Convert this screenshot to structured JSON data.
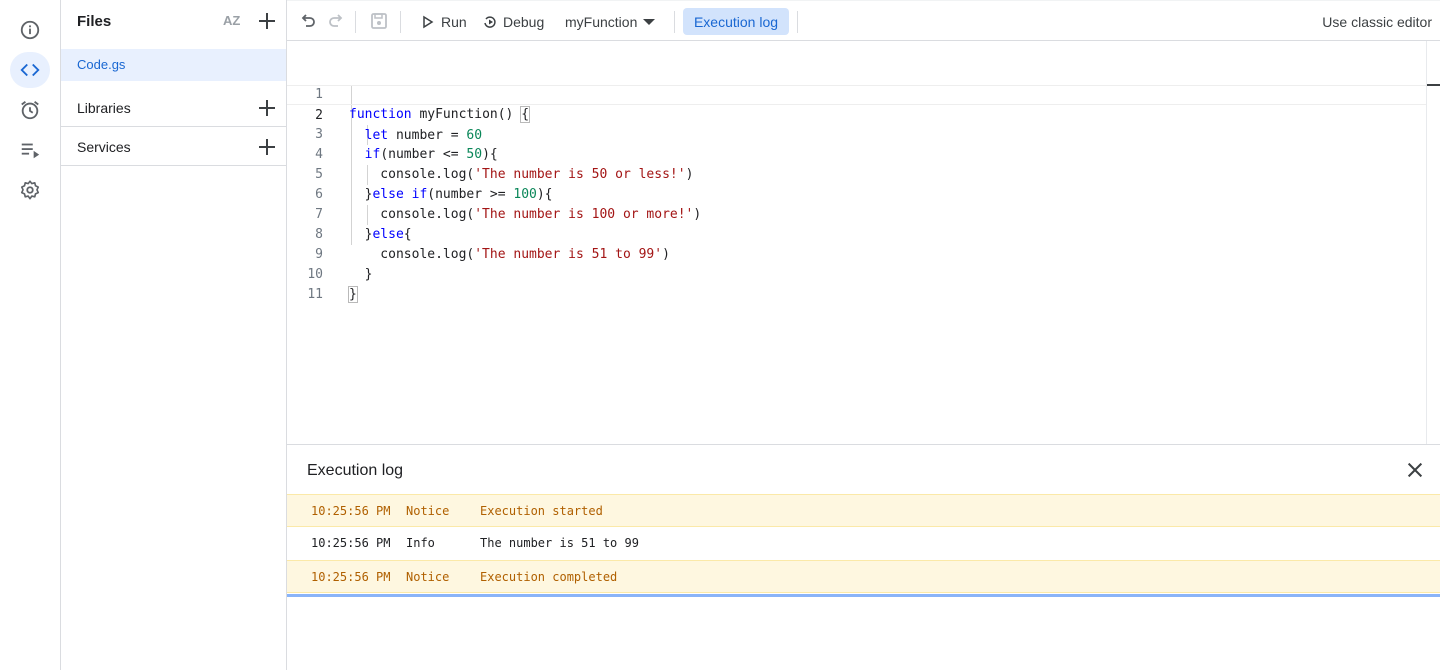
{
  "rail": {
    "items": [
      {
        "name": "overview",
        "icon": "info-icon",
        "active": false
      },
      {
        "name": "editor",
        "icon": "code-icon",
        "active": true
      },
      {
        "name": "triggers",
        "icon": "alarm-clock-icon",
        "active": false
      },
      {
        "name": "executions",
        "icon": "executions-list-icon",
        "active": false
      },
      {
        "name": "settings",
        "icon": "gear-icon",
        "active": false
      }
    ]
  },
  "files_panel": {
    "title": "Files",
    "sort_icon_text": "AZ",
    "files": [
      {
        "name": "Code.gs",
        "selected": true
      }
    ],
    "sections": [
      {
        "label": "Libraries"
      },
      {
        "label": "Services"
      }
    ]
  },
  "toolbar": {
    "run_label": "Run",
    "debug_label": "Debug",
    "function_name": "myFunction",
    "execution_log_label": "Execution log",
    "classic_editor_label": "Use classic editor"
  },
  "editor": {
    "current_line": 2,
    "line_numbers": [
      "1",
      "2",
      "3",
      "4",
      "5",
      "6",
      "7",
      "8",
      "9",
      "10",
      "11"
    ]
  },
  "log": {
    "title": "Execution log",
    "rows": [
      {
        "time": "10:25:56 PM",
        "level": "Notice",
        "message": "Execution started"
      },
      {
        "time": "10:25:56 PM",
        "level": "Info",
        "message": "The number is 51 to 99"
      },
      {
        "time": "10:25:56 PM",
        "level": "Notice",
        "message": "Execution completed"
      }
    ]
  },
  "colors": {
    "accent": "#1967d2",
    "accent_bg": "#e8f0fe",
    "notice_bg": "#fef7e0",
    "notice_text": "#b06000",
    "keyword": "#0000ff",
    "number": "#098658",
    "string": "#a31515"
  }
}
